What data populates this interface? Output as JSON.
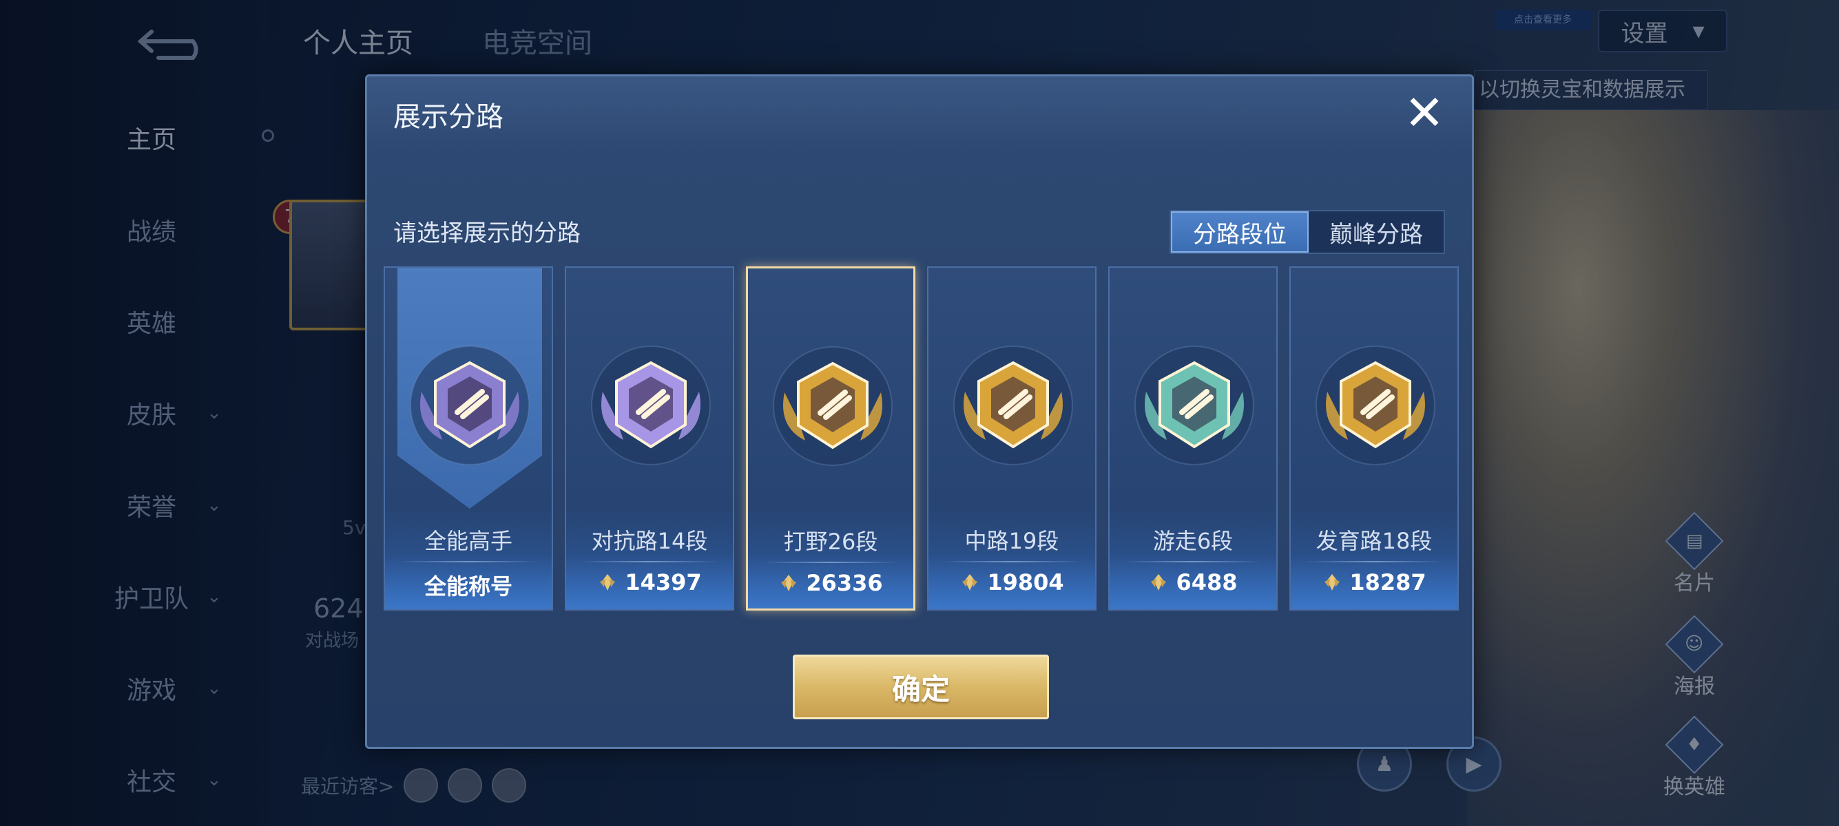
{
  "background": {
    "top_tabs": [
      "个人主页",
      "电竞空间"
    ],
    "nav": [
      {
        "label": "主页",
        "chevron": false,
        "active": true
      },
      {
        "label": "战绩",
        "chevron": false
      },
      {
        "label": "英雄",
        "chevron": false
      },
      {
        "label": "皮肤",
        "chevron": true
      },
      {
        "label": "荣誉",
        "chevron": true
      },
      {
        "label": "护卫队",
        "chevron": true
      },
      {
        "label": "游戏",
        "chevron": true
      },
      {
        "label": "社交",
        "chevron": true
      }
    ],
    "settings_label": "设置",
    "small_badge": "点击查看更多",
    "hint_text": "以切换灵宝和数据展示",
    "level": "7",
    "mode_text": "5v",
    "stat_value": "624",
    "stat_label": "对战场",
    "recent_visitors": "最近访客>",
    "right_actions": [
      {
        "label": "名片",
        "icon": "card-icon"
      },
      {
        "label": "海报",
        "icon": "poster-icon"
      },
      {
        "label": "换英雄",
        "icon": "switch-hero-icon"
      }
    ]
  },
  "modal": {
    "title": "展示分路",
    "close_icon": "close-icon",
    "subtitle": "请选择展示的分路",
    "toggle": {
      "options": [
        "分路段位",
        "巅峰分路"
      ],
      "active": 0
    },
    "cards": [
      {
        "name": "全能高手",
        "value": "全能称号",
        "emblem": "all-round-emblem",
        "color": "#8b7fd0",
        "show_points_icon": false
      },
      {
        "name": "对抗路14段",
        "value": "14397",
        "emblem": "clash-lane-emblem",
        "color": "#a795e6",
        "show_points_icon": true
      },
      {
        "name": "打野26段",
        "value": "26336",
        "emblem": "jungle-emblem",
        "color": "#d9a43a",
        "show_points_icon": true,
        "selected": true
      },
      {
        "name": "中路19段",
        "value": "19804",
        "emblem": "mid-lane-emblem",
        "color": "#d9a43a",
        "show_points_icon": true
      },
      {
        "name": "游走6段",
        "value": "6488",
        "emblem": "roam-emblem",
        "color": "#6ec2b4",
        "show_points_icon": true
      },
      {
        "name": "发育路18段",
        "value": "18287",
        "emblem": "farm-lane-emblem",
        "color": "#d9a43a",
        "show_points_icon": true
      }
    ],
    "confirm_label": "确定"
  },
  "colors": {
    "accent_gold": "#d9b867",
    "modal_bg": "#2a446c",
    "toggle_active": "#3b6db3"
  }
}
